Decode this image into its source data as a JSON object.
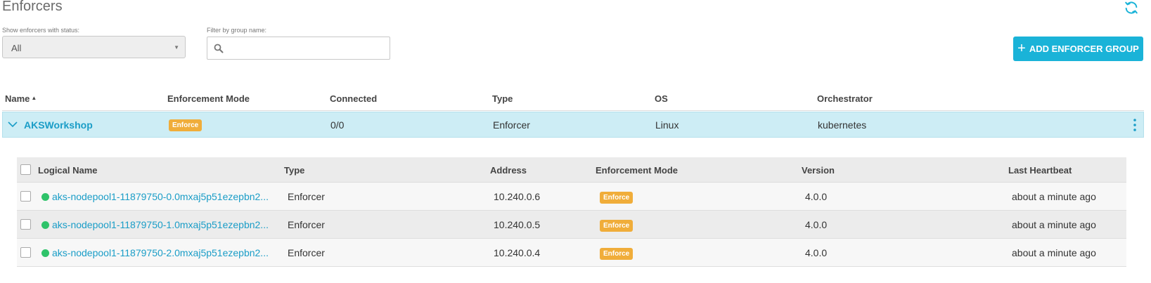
{
  "page": {
    "title": "Enforcers"
  },
  "filters": {
    "status_label": "Show enforcers with status:",
    "status_value": "All",
    "group_label": "Filter by group name:",
    "group_value": "",
    "group_placeholder": ""
  },
  "toolbar": {
    "add_button_label": "ADD ENFORCER GROUP"
  },
  "colors": {
    "accent": "#1ab3d8",
    "link": "#1a9dc7",
    "badge": "#f0ad3a",
    "status_ok": "#2fc36a",
    "group_row_bg": "#cdedf5"
  },
  "table": {
    "headers": {
      "name": "Name",
      "enforcement_mode": "Enforcement Mode",
      "connected": "Connected",
      "type": "Type",
      "os": "OS",
      "orchestrator": "Orchestrator"
    },
    "group": {
      "name": "AKSWorkshop",
      "enforcement_mode": "Enforce",
      "connected": "0/0",
      "type": "Enforcer",
      "os": "Linux",
      "orchestrator": "kubernetes"
    }
  },
  "enforcers": {
    "headers": {
      "logical_name": "Logical Name",
      "type": "Type",
      "address": "Address",
      "enforcement_mode": "Enforcement Mode",
      "version": "Version",
      "last_heartbeat": "Last Heartbeat"
    },
    "rows": [
      {
        "logical_name": "aks-nodepool1-11879750-0.0mxaj5p51ezepbn2...",
        "type": "Enforcer",
        "address": "10.240.0.6",
        "enforcement_mode": "Enforce",
        "version": "4.0.0",
        "last_heartbeat": "about a minute ago"
      },
      {
        "logical_name": "aks-nodepool1-11879750-1.0mxaj5p51ezepbn2...",
        "type": "Enforcer",
        "address": "10.240.0.5",
        "enforcement_mode": "Enforce",
        "version": "4.0.0",
        "last_heartbeat": "about a minute ago"
      },
      {
        "logical_name": "aks-nodepool1-11879750-2.0mxaj5p51ezepbn2...",
        "type": "Enforcer",
        "address": "10.240.0.4",
        "enforcement_mode": "Enforce",
        "version": "4.0.0",
        "last_heartbeat": "about a minute ago"
      }
    ]
  }
}
